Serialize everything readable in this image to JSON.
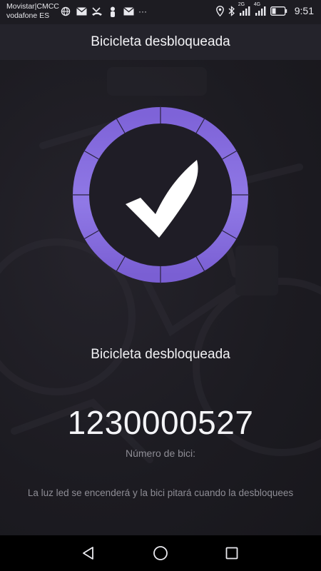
{
  "status_bar": {
    "carrier_1": "Movistar|CMCC",
    "carrier_2": "vodafone ES",
    "more": "···",
    "network_1": "2G",
    "network_2": "4G",
    "time": "9:51"
  },
  "header": {
    "title": "Bicicleta desbloqueada"
  },
  "main": {
    "status_title": "Bicicleta desbloqueada",
    "bike_number": "1230000527",
    "bike_number_label": "Número de bici:",
    "hint": "La luz led se encenderá y la bici pitará cuando la desbloquees"
  },
  "colors": {
    "accent": "#8b6ee0",
    "background": "#1c1b21",
    "header": "#24232b"
  },
  "icons": {
    "status_left": [
      "globe-icon",
      "mail-icon",
      "missed-call-icon",
      "person-icon",
      "mail-icon"
    ],
    "status_right": [
      "location-icon",
      "bluetooth-icon",
      "signal-icon",
      "signal-icon",
      "battery-icon"
    ],
    "badge": "checkmark-icon",
    "nav": [
      "back-icon",
      "home-icon",
      "recents-icon"
    ]
  }
}
